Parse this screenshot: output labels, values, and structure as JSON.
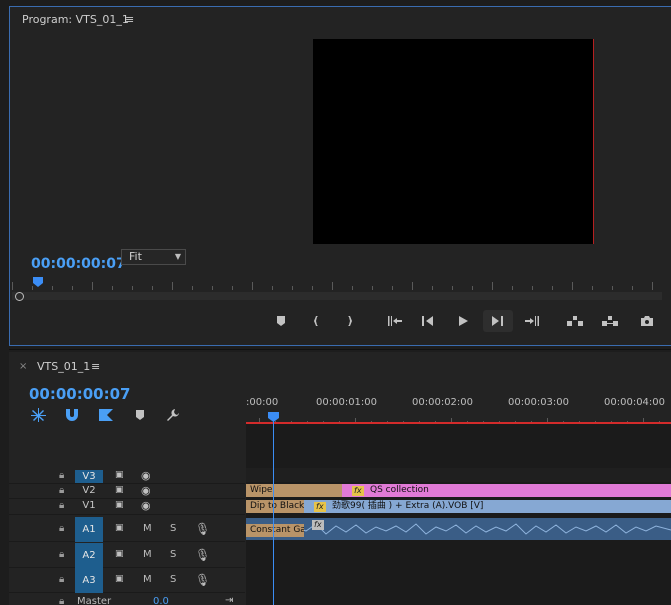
{
  "program": {
    "title": "Program: VTS_01_1",
    "menu_icon": "≡",
    "timecode": "00:00:00:07",
    "zoom_select": "Fit",
    "zoom_options": [
      "Fit"
    ]
  },
  "timeline": {
    "close_label": "×",
    "sequence_name": "VTS_01_1",
    "menu_icon": "≡",
    "timecode": "00:00:00:07",
    "ruler_labels": [
      ":00:00",
      "00:00:01:00",
      "00:00:02:00",
      "00:00:03:00",
      "00:00:04:00"
    ],
    "tracks": [
      {
        "name": "V3",
        "selected": true
      },
      {
        "name": "V2",
        "selected": false
      },
      {
        "name": "V1",
        "selected": false
      },
      {
        "name": "A1",
        "selected": true,
        "m": "M",
        "s": "S"
      },
      {
        "name": "A2",
        "selected": true,
        "m": "M",
        "s": "S"
      },
      {
        "name": "A3",
        "selected": true,
        "m": "M",
        "s": "S"
      }
    ],
    "master_label": "Master",
    "master_value": "0.0",
    "clips": {
      "v2_wipe": "Wipe",
      "v2_fx_label": "fx",
      "v2_main": "QS collection",
      "v1_dip": "Dip to Black",
      "v1_fx_label": "fx",
      "v1_main": "劲歌99( 插曲 ) + Extra (A).VOB [V]",
      "a1_gain": "Constant Gai",
      "a1_fx_label": "fx"
    }
  },
  "colors": {
    "accent_blue": "#4a9ff5",
    "playhead_blue": "#3b8df5",
    "clip_pink": "#e17ad6",
    "clip_blue": "#86a8d3",
    "audio_blue": "#3a5d86",
    "transition_tan": "#b99468",
    "track_selected": "#1e5e8e",
    "out_point_red": "#d32b2b"
  }
}
